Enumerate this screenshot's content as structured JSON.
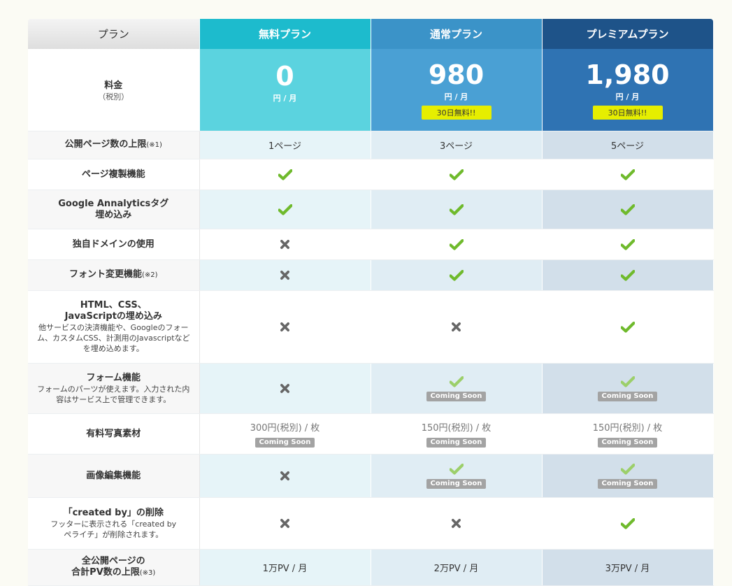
{
  "header": {
    "label": "プラン",
    "plans": [
      "無料プラン",
      "通常プラン",
      "プレミアムプラン"
    ]
  },
  "price_row": {
    "label": "料金",
    "sublabel": "（税別）",
    "prices": [
      "0",
      "980",
      "1,980"
    ],
    "unit": "円 / 月",
    "trial": "30日無料!!"
  },
  "features": {
    "page_limit": {
      "label": "公開ページ数の上限",
      "note": "(※1)",
      "values": [
        "1ページ",
        "3ページ",
        "5ページ"
      ]
    },
    "copy_page": {
      "label": "ページ複製機能"
    },
    "ga_tag": {
      "label_line1": "Google Annalyticsタグ",
      "label_line2": "埋め込み"
    },
    "own_domain": {
      "label": "独自ドメインの使用"
    },
    "font_change": {
      "label": "フォント変更機能",
      "note": "(※2)"
    },
    "embed_code": {
      "label_line1": "HTML、CSS、",
      "label_line2": "JavaScriptの埋め込み",
      "desc": "他サービスの決済機能や、Googleのフォーム、カスタムCSS、計測用のJavascriptなどを埋め込めます。"
    },
    "form": {
      "label": "フォーム機能",
      "desc": "フォームのパーツが使えます。入力された内容はサービス上で管理できます。"
    },
    "photo": {
      "label": "有料写真素材",
      "values": [
        "300円(税別) / 枚",
        "150円(税別) / 枚",
        "150円(税別) / 枚"
      ]
    },
    "image_edit": {
      "label": "画像編集機能"
    },
    "created_by": {
      "label": "「created by」の削除",
      "desc": "フッターに表示される「created by ペライチ」が削除されます。"
    },
    "pv_limit": {
      "label_line1": "全公開ページの",
      "label_line2": "合計PV数の上限",
      "note": "(※3)",
      "values": [
        "1万PV / 月",
        "2万PV / 月",
        "3万PV / 月"
      ]
    }
  },
  "coming_soon": "Coming Soon",
  "colors": {
    "free": "#1dbbcd",
    "standard": "#3b93c8",
    "premium": "#1e5389",
    "check": "#6fba2c",
    "check_light": "#9ccf6a",
    "cross": "#666666",
    "trial_badge": "#e6ee00"
  },
  "icons": [
    "check-icon",
    "cross-icon"
  ]
}
